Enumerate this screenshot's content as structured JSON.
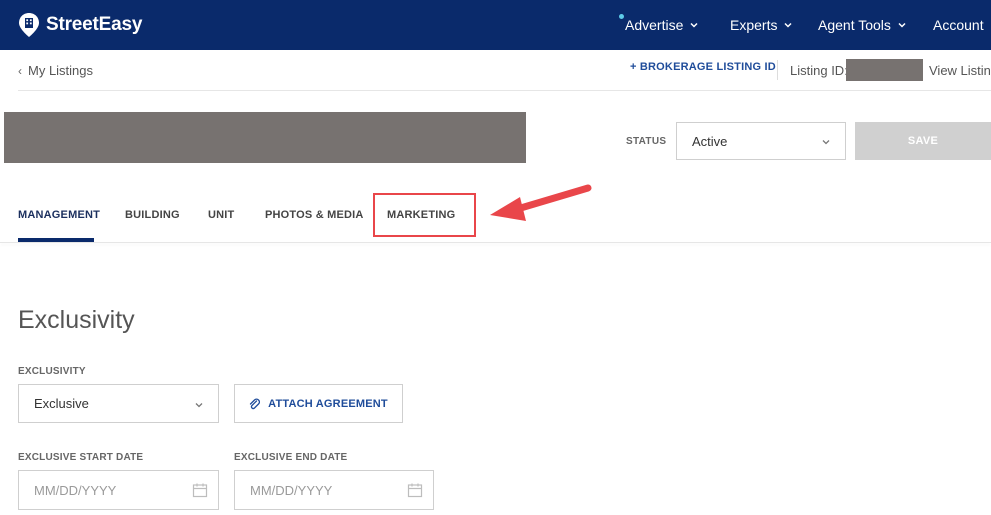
{
  "nav": {
    "brand": "StreetEasy",
    "items": [
      {
        "label": "Advertise"
      },
      {
        "label": "Experts"
      },
      {
        "label": "Agent Tools"
      },
      {
        "label": "Account"
      }
    ]
  },
  "subheader": {
    "back_label": "My Listings",
    "brokerage_link": "+ BROKERAGE LISTING ID",
    "listing_id_label": "Listing ID:",
    "view_listing": "View Listing"
  },
  "status": {
    "label": "STATUS",
    "value": "Active",
    "save_label": "SAVE"
  },
  "tabs": [
    {
      "label": "MANAGEMENT"
    },
    {
      "label": "BUILDING"
    },
    {
      "label": "UNIT"
    },
    {
      "label": "PHOTOS & MEDIA"
    },
    {
      "label": "MARKETING"
    }
  ],
  "section": {
    "title": "Exclusivity",
    "exclusivity_label": "EXCLUSIVITY",
    "exclusivity_value": "Exclusive",
    "attach_label": "ATTACH AGREEMENT",
    "start_label": "EXCLUSIVE START DATE",
    "end_label": "EXCLUSIVE END DATE",
    "start_placeholder": "MM/DD/YYYY",
    "end_placeholder": "MM/DD/YYYY"
  },
  "colors": {
    "nav_bg": "#0a2a6b",
    "accent_link": "#1f4c9a",
    "annotation": "#e9464a",
    "save_disabled": "#d0d0d0"
  }
}
